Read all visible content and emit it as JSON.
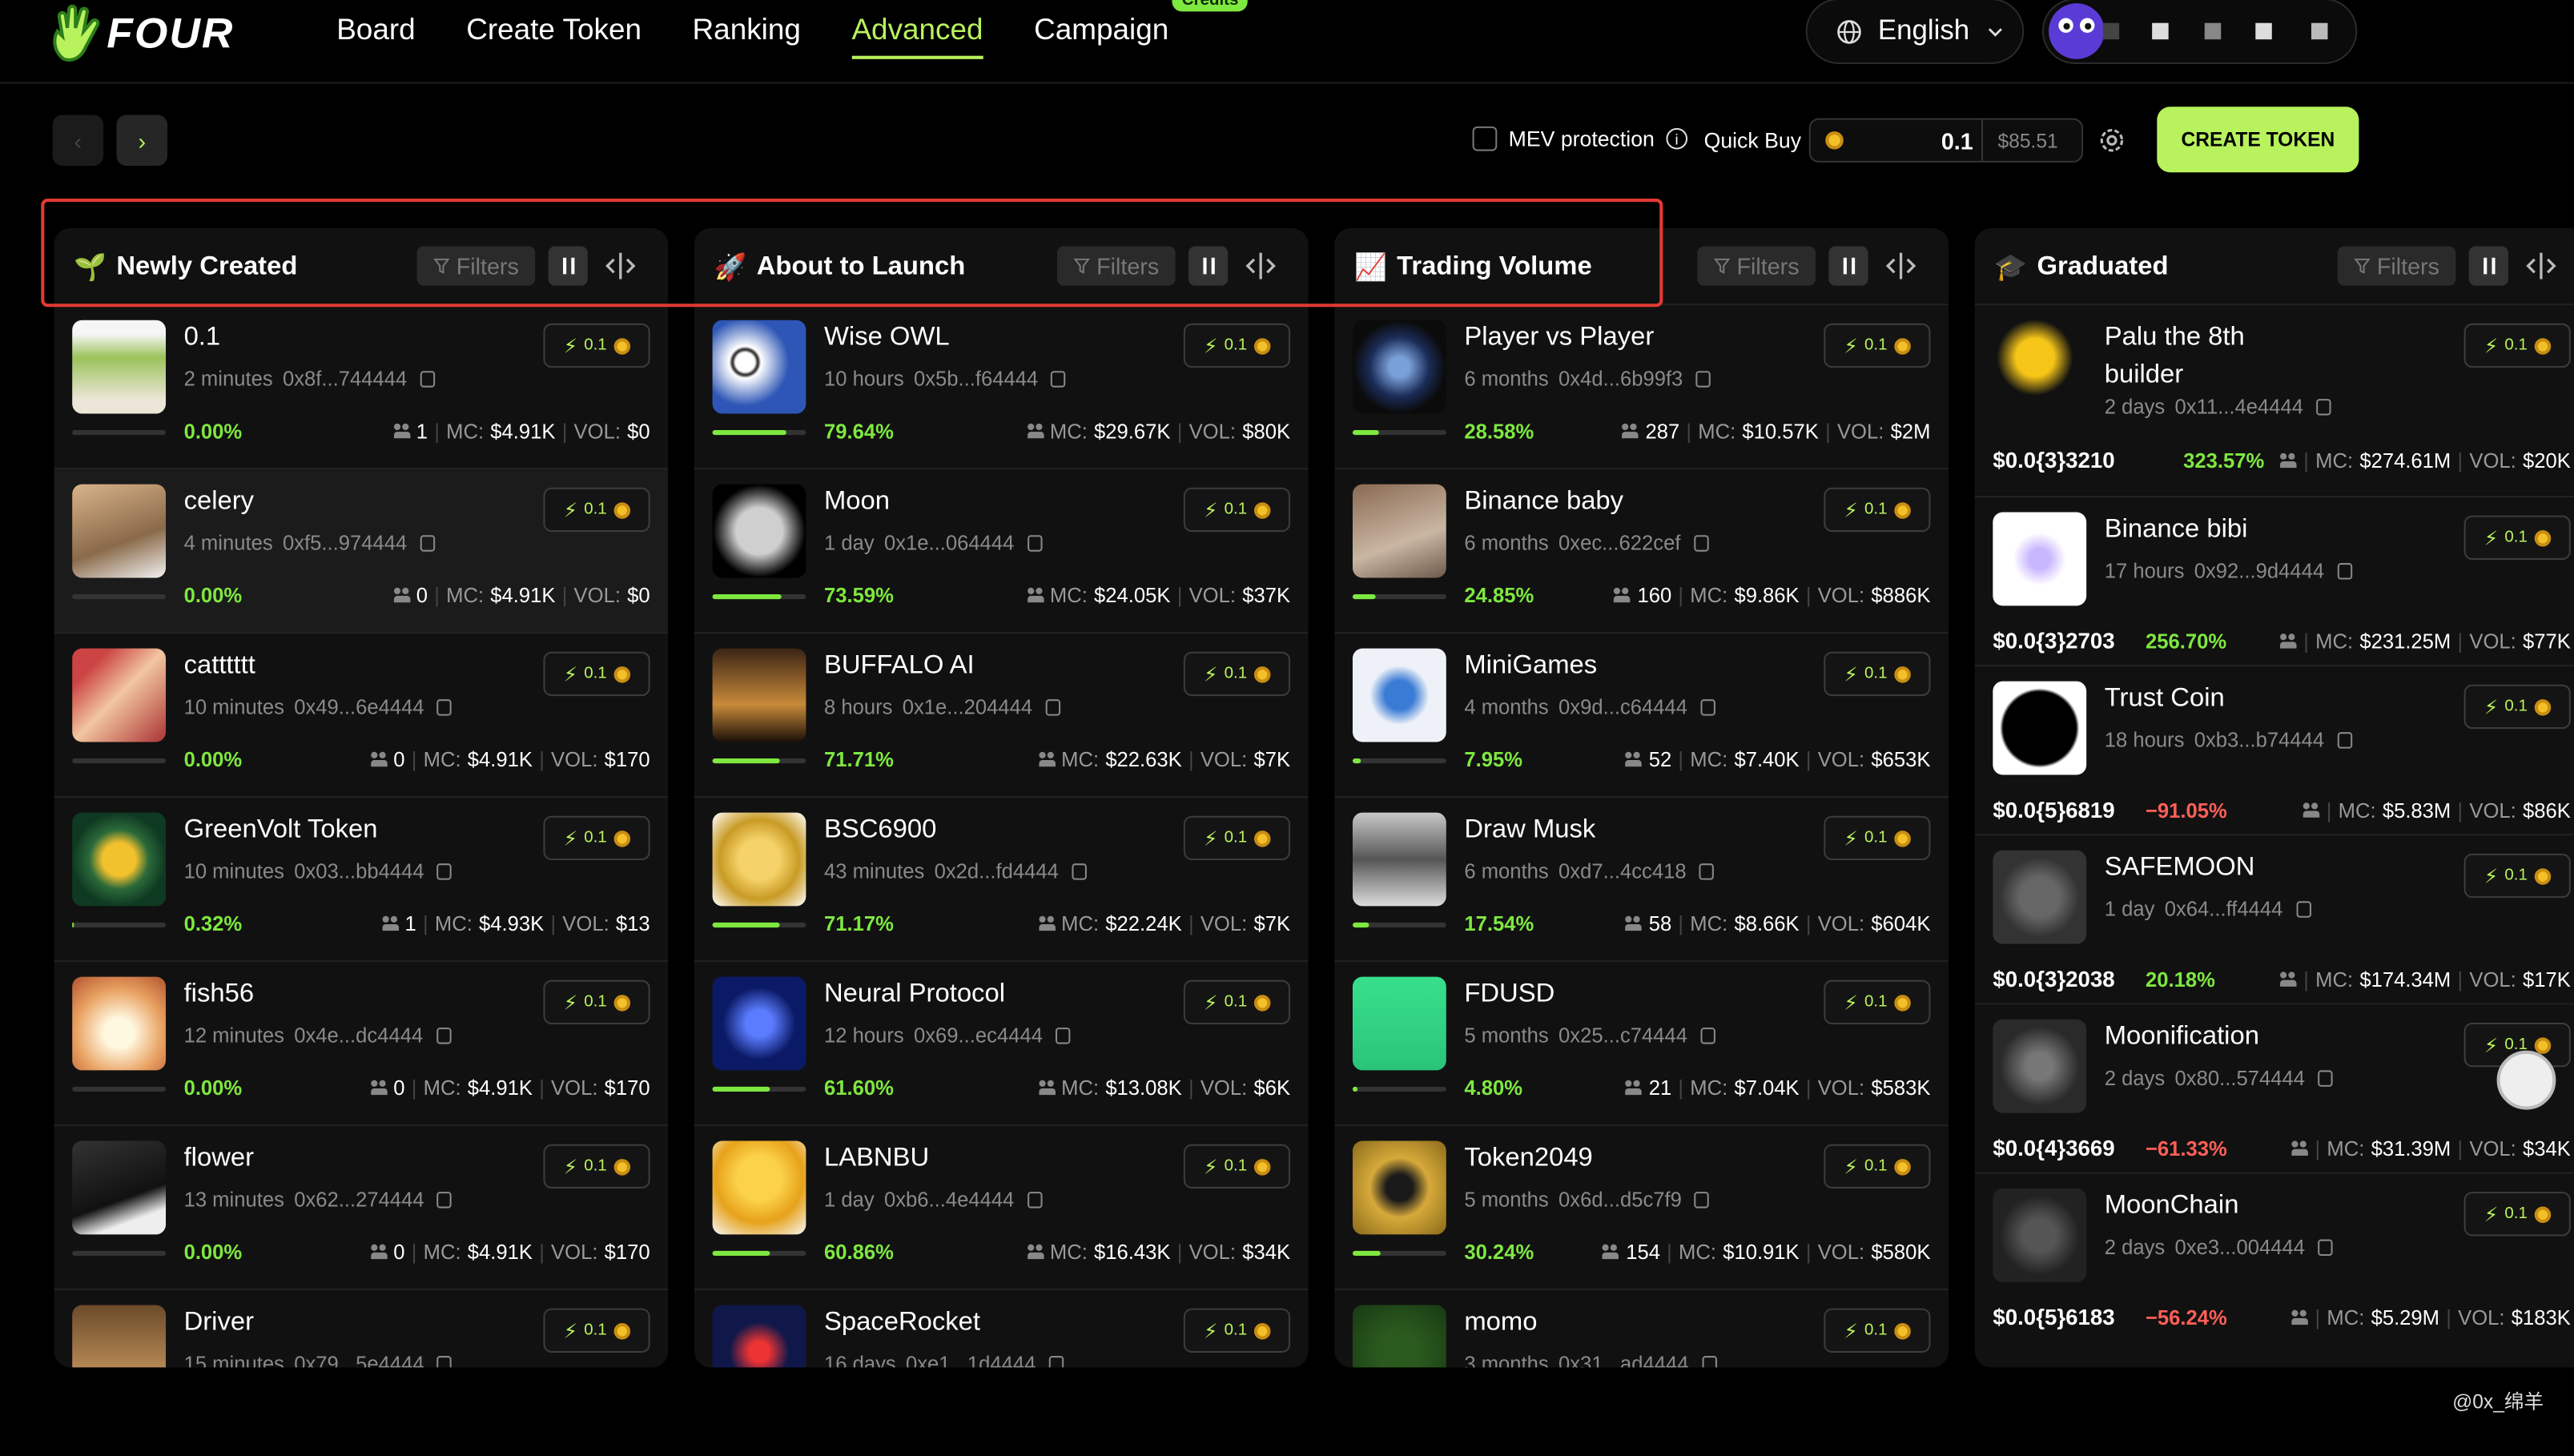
{
  "app": {
    "logo_text": "FOUR",
    "credits_badge": "Credits"
  },
  "nav": [
    {
      "label": "Board",
      "active": false
    },
    {
      "label": "Create Token",
      "active": false
    },
    {
      "label": "Ranking",
      "active": false
    },
    {
      "label": "Advanced",
      "active": true
    },
    {
      "label": "Campaign",
      "active": false
    }
  ],
  "header": {
    "language": "English"
  },
  "toolbar": {
    "back": "‹",
    "forward": "›",
    "mev_label": "MEV protection",
    "quick_buy_label": "Quick Buy",
    "quick_buy_value": "0.1",
    "quick_buy_usd": "$85.51",
    "create_token": "CREATE TOKEN"
  },
  "colors": {
    "accent": "#b8f25c",
    "green": "#7ee840",
    "red": "#ff5f57",
    "highlight_box": "#e23a31"
  },
  "columns": [
    {
      "emoji": "🌱",
      "title": "Newly Created",
      "filters": "Filters",
      "cards": [
        {
          "name": "0.1",
          "age": "2 minutes",
          "addr": "0x8f...744444",
          "buy": "0.1",
          "pct": "0.00%",
          "progress": 0,
          "holders": "1",
          "mc": "$4.91K",
          "vol": "$0"
        },
        {
          "name": "celery",
          "age": "4 minutes",
          "addr": "0xf5...974444",
          "buy": "0.1",
          "pct": "0.00%",
          "progress": 0,
          "holders": "0",
          "mc": "$4.91K",
          "vol": "$0"
        },
        {
          "name": "catttttt",
          "age": "10 minutes",
          "addr": "0x49...6e4444",
          "buy": "0.1",
          "pct": "0.00%",
          "progress": 0,
          "holders": "0",
          "mc": "$4.91K",
          "vol": "$170"
        },
        {
          "name": "GreenVolt Token",
          "age": "10 minutes",
          "addr": "0x03...bb4444",
          "buy": "0.1",
          "pct": "0.32%",
          "progress": 0.32,
          "holders": "1",
          "mc": "$4.93K",
          "vol": "$13"
        },
        {
          "name": "fish56",
          "age": "12 minutes",
          "addr": "0x4e...dc4444",
          "buy": "0.1",
          "pct": "0.00%",
          "progress": 0,
          "holders": "0",
          "mc": "$4.91K",
          "vol": "$170"
        },
        {
          "name": "flower",
          "age": "13 minutes",
          "addr": "0x62...274444",
          "buy": "0.1",
          "pct": "0.00%",
          "progress": 0,
          "holders": "0",
          "mc": "$4.91K",
          "vol": "$170"
        },
        {
          "name": "Driver",
          "age": "15 minutes",
          "addr": "0x79...5e4444",
          "buy": "0.1",
          "pct": "",
          "progress": 0,
          "holders": "",
          "mc": "",
          "vol": ""
        }
      ]
    },
    {
      "emoji": "🚀",
      "title": "About to Launch",
      "filters": "Filters",
      "cards": [
        {
          "name": "Wise OWL",
          "age": "10 hours",
          "addr": "0x5b...f64444",
          "buy": "0.1",
          "pct": "79.64%",
          "progress": 79.64,
          "holders": "",
          "mc": "$29.67K",
          "vol": "$80K"
        },
        {
          "name": "Moon",
          "age": "1 day",
          "addr": "0x1e...064444",
          "buy": "0.1",
          "pct": "73.59%",
          "progress": 73.59,
          "holders": "",
          "mc": "$24.05K",
          "vol": "$37K"
        },
        {
          "name": "BUFFALO AI",
          "age": "8 hours",
          "addr": "0x1e...204444",
          "buy": "0.1",
          "pct": "71.71%",
          "progress": 71.71,
          "holders": "",
          "mc": "$22.63K",
          "vol": "$7K"
        },
        {
          "name": "BSC6900",
          "age": "43 minutes",
          "addr": "0x2d...fd4444",
          "buy": "0.1",
          "pct": "71.17%",
          "progress": 71.17,
          "holders": "",
          "mc": "$22.24K",
          "vol": "$7K"
        },
        {
          "name": "Neural Protocol",
          "age": "12 hours",
          "addr": "0x69...ec4444",
          "buy": "0.1",
          "pct": "61.60%",
          "progress": 61.6,
          "holders": "",
          "mc": "$13.08K",
          "vol": "$6K"
        },
        {
          "name": "LABNBU",
          "age": "1 day",
          "addr": "0xb6...4e4444",
          "buy": "0.1",
          "pct": "60.86%",
          "progress": 60.86,
          "holders": "",
          "mc": "$16.43K",
          "vol": "$34K"
        },
        {
          "name": "SpaceRocket",
          "age": "16 days",
          "addr": "0xe1...1d4444",
          "buy": "0.1",
          "pct": "",
          "progress": 0,
          "holders": "",
          "mc": "",
          "vol": ""
        }
      ]
    },
    {
      "emoji": "📈",
      "title": "Trading Volume",
      "filters": "Filters",
      "cards": [
        {
          "name": "Player vs Player",
          "age": "6 months",
          "addr": "0x4d...6b99f3",
          "buy": "0.1",
          "pct": "28.58%",
          "progress": 28.58,
          "holders": "287",
          "mc": "$10.57K",
          "vol": "$2M"
        },
        {
          "name": "Binance baby",
          "age": "6 months",
          "addr": "0xec...622cef",
          "buy": "0.1",
          "pct": "24.85%",
          "progress": 24.85,
          "holders": "160",
          "mc": "$9.86K",
          "vol": "$886K"
        },
        {
          "name": "MiniGames",
          "age": "4 months",
          "addr": "0x9d...c64444",
          "buy": "0.1",
          "pct": "7.95%",
          "progress": 7.95,
          "holders": "52",
          "mc": "$7.40K",
          "vol": "$653K"
        },
        {
          "name": "Draw Musk",
          "age": "6 months",
          "addr": "0xd7...4cc418",
          "buy": "0.1",
          "pct": "17.54%",
          "progress": 17.54,
          "holders": "58",
          "mc": "$8.66K",
          "vol": "$604K"
        },
        {
          "name": "FDUSD",
          "age": "5 months",
          "addr": "0x25...c74444",
          "buy": "0.1",
          "pct": "4.80%",
          "progress": 4.8,
          "holders": "21",
          "mc": "$7.04K",
          "vol": "$583K"
        },
        {
          "name": "Token2049",
          "age": "5 months",
          "addr": "0x6d...d5c7f9",
          "buy": "0.1",
          "pct": "30.24%",
          "progress": 30.24,
          "holders": "154",
          "mc": "$10.91K",
          "vol": "$580K"
        },
        {
          "name": "momo",
          "age": "3 months",
          "addr": "0x31...ad4444",
          "buy": "0.1",
          "pct": "",
          "progress": 0,
          "holders": "",
          "mc": "",
          "vol": ""
        }
      ]
    },
    {
      "emoji": "🎓",
      "title": "Graduated",
      "filters": "Filters",
      "cards": [
        {
          "name": "Palu the 8th builder",
          "age": "2 days",
          "addr": "0x11...4e4444",
          "buy": "0.1",
          "price": "$0.0{3}3210",
          "pct": "323.57%",
          "up": true,
          "mc": "$274.61M",
          "vol": "$20K"
        },
        {
          "name": "Binance bibi",
          "age": "17 hours",
          "addr": "0x92...9d4444",
          "buy": "0.1",
          "price": "$0.0{3}2703",
          "pct": "256.70%",
          "up": true,
          "mc": "$231.25M",
          "vol": "$77K"
        },
        {
          "name": "Trust Coin",
          "age": "18 hours",
          "addr": "0xb3...b74444",
          "buy": "0.1",
          "price": "$0.0{5}6819",
          "pct": "−91.05%",
          "up": false,
          "mc": "$5.83M",
          "vol": "$86K"
        },
        {
          "name": "SAFEMOON",
          "age": "1 day",
          "addr": "0x64...ff4444",
          "buy": "0.1",
          "price": "$0.0{3}2038",
          "pct": "20.18%",
          "up": true,
          "mc": "$174.34M",
          "vol": "$17K"
        },
        {
          "name": "Moonification",
          "age": "2 days",
          "addr": "0x80...574444",
          "buy": "0.1",
          "price": "$0.0{4}3669",
          "pct": "−61.33%",
          "up": false,
          "mc": "$31.39M",
          "vol": "$34K"
        },
        {
          "name": "MoonChain",
          "age": "2 days",
          "addr": "0xe3...004444",
          "buy": "0.1",
          "price": "$0.0{5}6183",
          "pct": "−56.24%",
          "up": false,
          "mc": "$5.29M",
          "vol": "$183K"
        }
      ]
    }
  ],
  "watermark": "@0x_绵羊"
}
